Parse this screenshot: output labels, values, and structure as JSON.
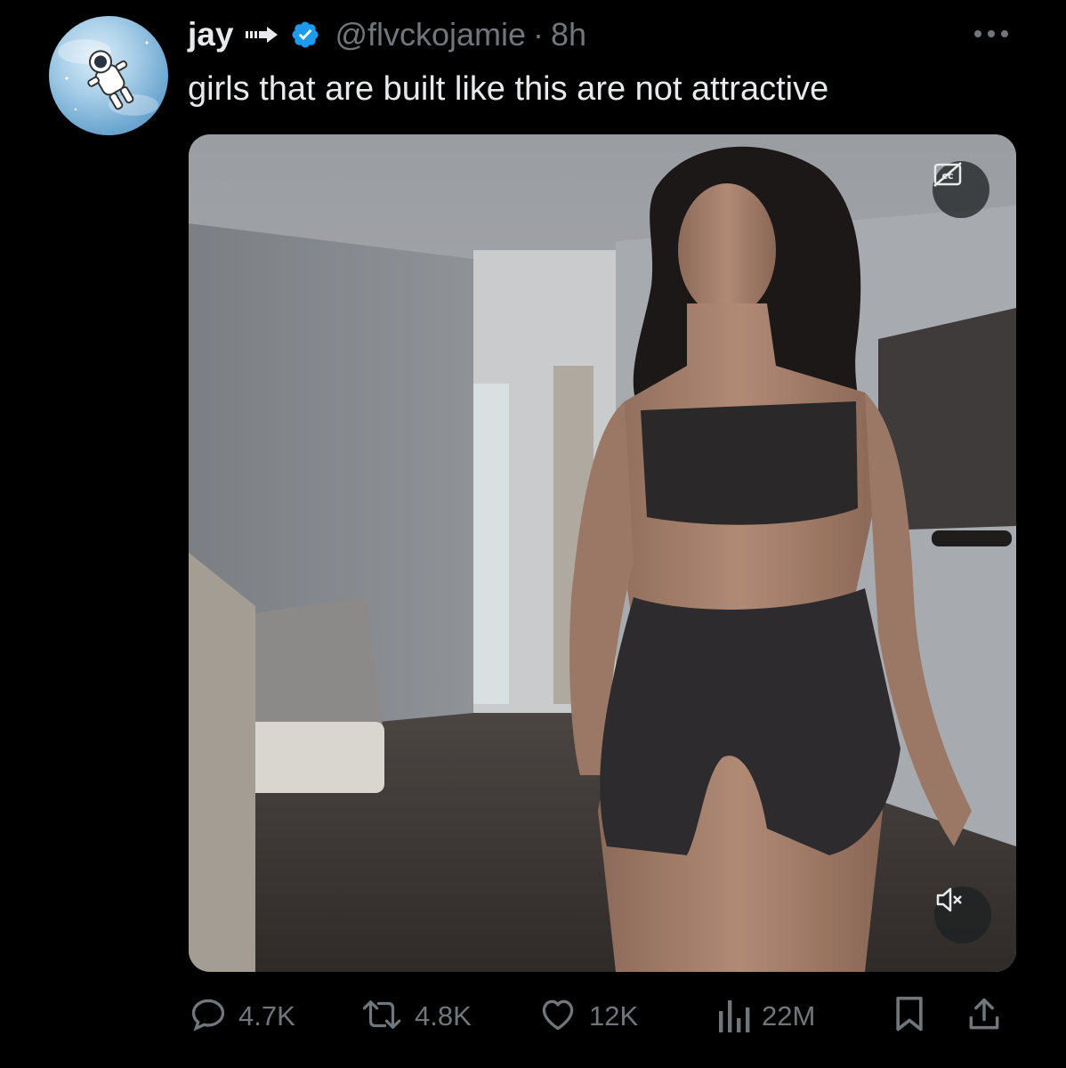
{
  "tweet": {
    "display_name": "jay",
    "handle": "@flvckojamie",
    "separator": "·",
    "time": "8h",
    "text": "girls that are built like this are not attractive",
    "icons": {
      "arrow": "arrow-right-icon",
      "verified": "verified-badge-icon",
      "more": "more-options-icon",
      "captions": "captions-off-icon",
      "mute": "volume-muted-icon"
    },
    "colors": {
      "background": "#000000",
      "text": "#e7e9ea",
      "muted_text": "#71767b",
      "verified_blue": "#1d9bf0"
    }
  },
  "actions": {
    "replies": {
      "icon": "reply-icon",
      "count": "4.7K"
    },
    "reposts": {
      "icon": "repost-icon",
      "count": "4.8K"
    },
    "likes": {
      "icon": "heart-icon",
      "count": "12K"
    },
    "views": {
      "icon": "views-chart-icon",
      "count": "22M"
    },
    "bookmark": {
      "icon": "bookmark-icon"
    },
    "share": {
      "icon": "share-icon"
    }
  }
}
